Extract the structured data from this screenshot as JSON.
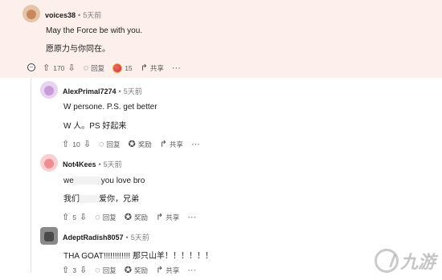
{
  "comments": [
    {
      "author": "voices38",
      "time": "5天前",
      "lines": [
        "May the Force be with you.",
        "愿原力与你同在。"
      ],
      "votes": "170",
      "reply_label": "回复",
      "award_count": "15",
      "share_label": "共享",
      "more_label": "···"
    },
    {
      "author": "AlexPrimal7274",
      "time": "5天前",
      "lines": [
        "W persone. P.S. get better",
        "W 人。PS 好起来"
      ],
      "votes": "10",
      "reply_label": "回复",
      "award_label": "奖励",
      "share_label": "共享",
      "more_label": "···"
    },
    {
      "author": "Not4Kees",
      "time": "5天前",
      "line1_prefix": "we",
      "line1_suffix": "you love bro",
      "line2_prefix": "我们",
      "line2_suffix": "爱你，兄弟",
      "votes": "5",
      "reply_label": "回复",
      "award_label": "奖励",
      "share_label": "共享",
      "more_label": "···"
    },
    {
      "author": "AdeptRadish8057",
      "time": "5天前",
      "lines": [
        "THA GOAT!!!!!!!!!!!!   那只山羊！！！！！！"
      ],
      "votes": "3",
      "reply_label": "回复",
      "award_label": "奖励",
      "share_label": "共享",
      "more_label": "···"
    }
  ],
  "separator": "•",
  "collapse_symbol": "−",
  "watermark": {
    "text": "九游"
  },
  "icons": {
    "upvote": "upvote-arrow-icon",
    "downvote": "downvote-arrow-icon",
    "reply": "speech-bubble-icon",
    "award": "award-ribbon-icon",
    "share": "share-arrow-icon",
    "more": "ellipsis-icon"
  },
  "colors": {
    "highlight_bg": "#fdf0ec",
    "avatar_voices38": "#c8875e",
    "avatar_alex": "#c99ad8",
    "avatar_not4kees": "#ef8d93",
    "avatar_adept": "#6d6d6d"
  }
}
